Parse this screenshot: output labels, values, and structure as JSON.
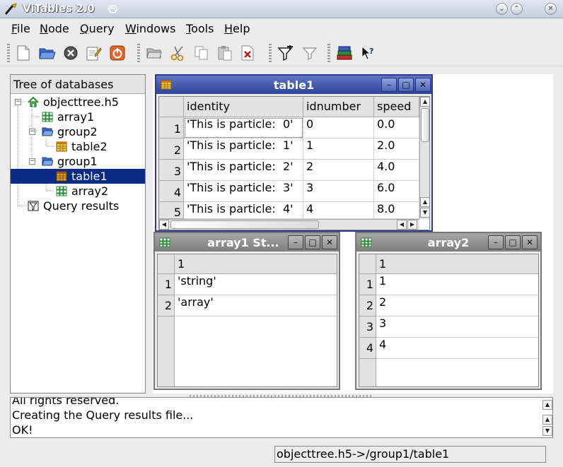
{
  "window": {
    "title": "ViTables 2.0"
  },
  "menu": [
    {
      "label": "File",
      "ul": "F",
      "rest": "ile"
    },
    {
      "label": "Node",
      "ul": "N",
      "rest": "ode"
    },
    {
      "label": "Query",
      "ul": "Q",
      "rest": "uery"
    },
    {
      "label": "Windows",
      "ul": "W",
      "rest": "indows"
    },
    {
      "label": "Tools",
      "ul": "T",
      "rest": "ools"
    },
    {
      "label": "Help",
      "ul": "H",
      "rest": "elp"
    }
  ],
  "tree": {
    "header": "Tree of databases",
    "items": [
      {
        "label": "objecttree.h5",
        "icon": "home-icon"
      },
      {
        "label": "array1",
        "icon": "array-icon"
      },
      {
        "label": "group2",
        "icon": "folder-open-icon"
      },
      {
        "label": "table2",
        "icon": "table-icon"
      },
      {
        "label": "group1",
        "icon": "folder-open-icon"
      },
      {
        "label": "table1",
        "icon": "table-icon",
        "selected": true
      },
      {
        "label": "array2",
        "icon": "array-icon"
      },
      {
        "label": "Query results",
        "icon": "query-icon"
      }
    ]
  },
  "table1": {
    "title": "table1",
    "columns": [
      "identity",
      "idnumber",
      "speed"
    ],
    "rows": [
      {
        "n": "1",
        "cells": [
          "'This is particle:  0'",
          "0",
          "0.0"
        ]
      },
      {
        "n": "2",
        "cells": [
          "'This is particle:  1'",
          "1",
          "2.0"
        ]
      },
      {
        "n": "3",
        "cells": [
          "'This is particle:  2'",
          "2",
          "4.0"
        ]
      },
      {
        "n": "4",
        "cells": [
          "'This is particle:  3'",
          "3",
          "6.0"
        ]
      },
      {
        "n": "5",
        "cells": [
          "'This is particle:  4'",
          "4",
          "8.0"
        ]
      }
    ]
  },
  "array1": {
    "title": "array1 St...",
    "columns": [
      "1"
    ],
    "rows": [
      {
        "n": "1",
        "cells": [
          "'string'"
        ]
      },
      {
        "n": "2",
        "cells": [
          "'array'"
        ]
      }
    ]
  },
  "array2": {
    "title": "array2",
    "columns": [
      "1"
    ],
    "rows": [
      {
        "n": "1",
        "cells": [
          "1"
        ]
      },
      {
        "n": "2",
        "cells": [
          "2"
        ]
      },
      {
        "n": "3",
        "cells": [
          "3"
        ]
      },
      {
        "n": "4",
        "cells": [
          "4"
        ]
      }
    ]
  },
  "log": {
    "lines": [
      "All rights reserved.",
      "Creating the Query results file...",
      "OK!"
    ]
  },
  "status": {
    "path": "objecttree.h5->/group1/table1"
  },
  "window_buttons": {
    "minimize": "–",
    "maximize": "□",
    "close": "✕"
  },
  "colors": {
    "selection": "#0a2a85",
    "active_title": "#2f4596",
    "inactive_title": "#7e7e7e"
  }
}
